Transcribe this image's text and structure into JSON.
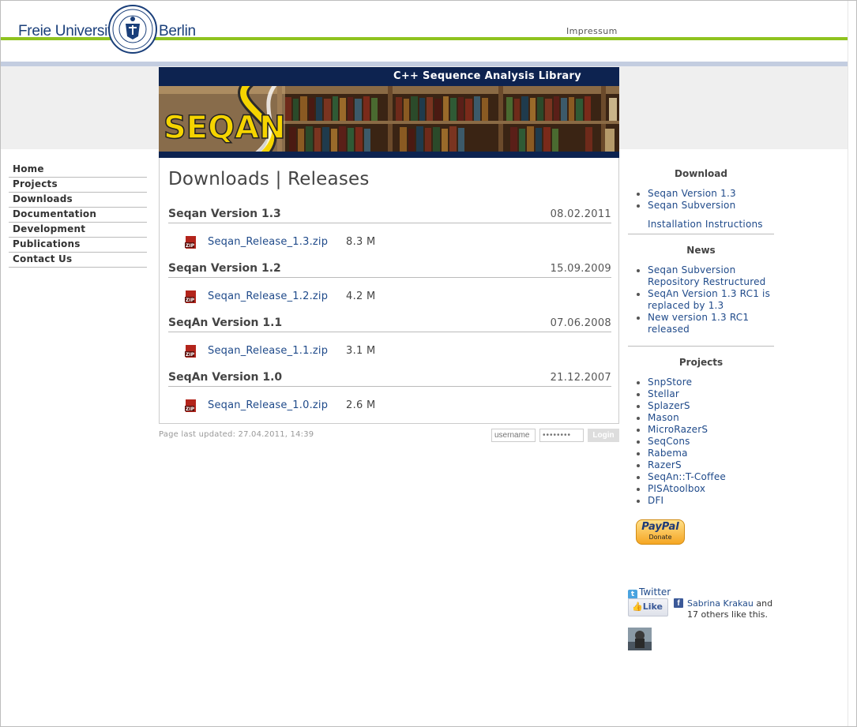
{
  "header": {
    "university_left": "Freie Universität",
    "university_right": "Berlin",
    "impressum": "Impressum"
  },
  "banner": {
    "title": "C++ Sequence Analysis Library",
    "logo_text": "SEQAN"
  },
  "nav": {
    "items": [
      {
        "label": "Home"
      },
      {
        "label": "Projects"
      },
      {
        "label": "Downloads"
      },
      {
        "label": "Documentation"
      },
      {
        "label": "Development"
      },
      {
        "label": "Publications"
      },
      {
        "label": "Contact Us"
      }
    ]
  },
  "main": {
    "title": "Downloads | Releases",
    "releases": [
      {
        "name": "Seqan Version 1.3",
        "date": "08.02.2011",
        "file": "Seqan_Release_1.3.zip",
        "size": "8.3 M"
      },
      {
        "name": "Seqan Version 1.2",
        "date": "15.09.2009",
        "file": "Seqan_Release_1.2.zip",
        "size": "4.2 M"
      },
      {
        "name": "SeqAn Version 1.1",
        "date": "07.06.2008",
        "file": "Seqan_Release_1.1.zip",
        "size": "3.1 M"
      },
      {
        "name": "SeqAn Version 1.0",
        "date": "21.12.2007",
        "file": "Seqan_Release_1.0.zip",
        "size": "2.6 M"
      }
    ],
    "zip_icon_label": "ZIP"
  },
  "footer": {
    "updated": "Page last updated: 27.04.2011, 14:39",
    "username_placeholder": "username",
    "password_placeholder": "••••••••",
    "login_label": "Login"
  },
  "sidebar": {
    "download": {
      "heading": "Download",
      "items": [
        "Seqan Version 1.3",
        "Seqan Subversion"
      ],
      "install": "Installation Instructions"
    },
    "news": {
      "heading": "News",
      "items": [
        "Seqan Subversion Repository Restructured",
        "SeqAn Version 1.3 RC1 is replaced by 1.3",
        "New version 1.3 RC1 released"
      ]
    },
    "projects": {
      "heading": "Projects",
      "items": [
        "SnpStore",
        "Stellar",
        "SplazerS",
        "Mason",
        "MicroRazerS",
        "SeqCons",
        "Rabema",
        "RazerS",
        "SeqAn::T-Coffee",
        "PISAtoolbox",
        "DFI"
      ]
    },
    "paypal": {
      "brand": "PayPal",
      "donate": "Donate"
    },
    "twitter": "Twitter",
    "facebook": {
      "like": "Like",
      "friend": "Sabrina Krakau",
      "rest": " and 17 others like this."
    }
  },
  "colors": {
    "accent_green": "#8fc31f",
    "link_blue": "#1f4a8a",
    "banner_navy": "#0d2350",
    "logo_yellow": "#f5d400"
  }
}
